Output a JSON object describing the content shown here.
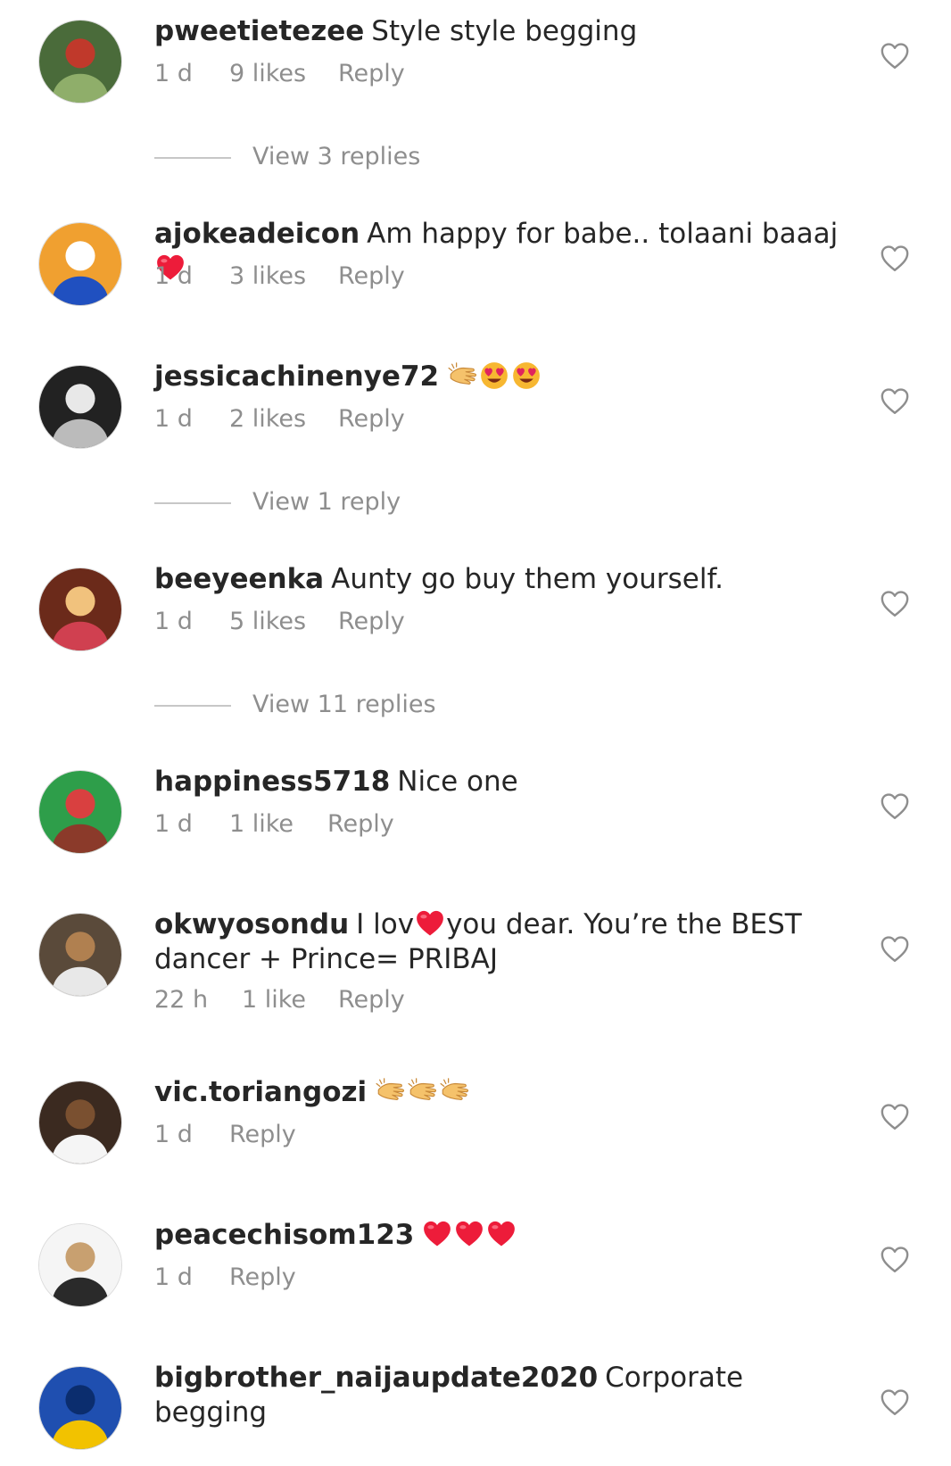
{
  "comments": [
    {
      "username": "pweetietezee",
      "text": "Style style begging",
      "emojis": [],
      "time": "1 d",
      "likes": "9 likes",
      "reply": "Reply",
      "view_replies": "View 3 replies"
    },
    {
      "username": "ajokeadeicon",
      "text": "Am happy for babe.. tolaani baaaj",
      "emojis": [
        "red-heart"
      ],
      "time": "1 d",
      "likes": "3 likes",
      "reply": "Reply",
      "view_replies": ""
    },
    {
      "username": "jessicachinenye72",
      "text": "",
      "emojis": [
        "clapping-hands",
        "heart-eyes-face",
        "heart-eyes-face"
      ],
      "time": "1 d",
      "likes": "2 likes",
      "reply": "Reply",
      "view_replies": "View 1 reply"
    },
    {
      "username": "beeyeenka",
      "text": "Aunty go buy them yourself.",
      "emojis": [],
      "time": "1 d",
      "likes": "5 likes",
      "reply": "Reply",
      "view_replies": "View 11 replies"
    },
    {
      "username": "happiness5718",
      "text": "Nice one",
      "emojis": [],
      "time": "1 d",
      "likes": "1 like",
      "reply": "Reply",
      "view_replies": ""
    },
    {
      "username": "okwyosondu",
      "text_before": "I lov",
      "inline_emoji": "red-heart",
      "text_after": "you dear. You’re the BEST dancer + Prince= PRIBAJ",
      "time": "22 h",
      "likes": "1 like",
      "reply": "Reply",
      "view_replies": ""
    },
    {
      "username": "vic.toriangozi",
      "text": "",
      "emojis": [
        "clapping-hands",
        "clapping-hands",
        "clapping-hands"
      ],
      "time": "1 d",
      "likes": "",
      "reply": "Reply",
      "view_replies": ""
    },
    {
      "username": "peacechisom123",
      "text": "",
      "emojis": [
        "red-heart",
        "red-heart",
        "red-heart"
      ],
      "time": "1 d",
      "likes": "",
      "reply": "Reply",
      "view_replies": ""
    },
    {
      "username": "bigbrother_naijaupdate2020",
      "text": "Corporate begging",
      "emojis": [],
      "time": "",
      "likes": "",
      "reply": "",
      "view_replies": ""
    }
  ],
  "colors": {
    "text": "#262626",
    "secondary": "#8e8e8e",
    "divider": "#c7c7c7",
    "heart_emoji": "#ed1c3a"
  },
  "icons": {
    "like": "heart-outline-icon"
  }
}
